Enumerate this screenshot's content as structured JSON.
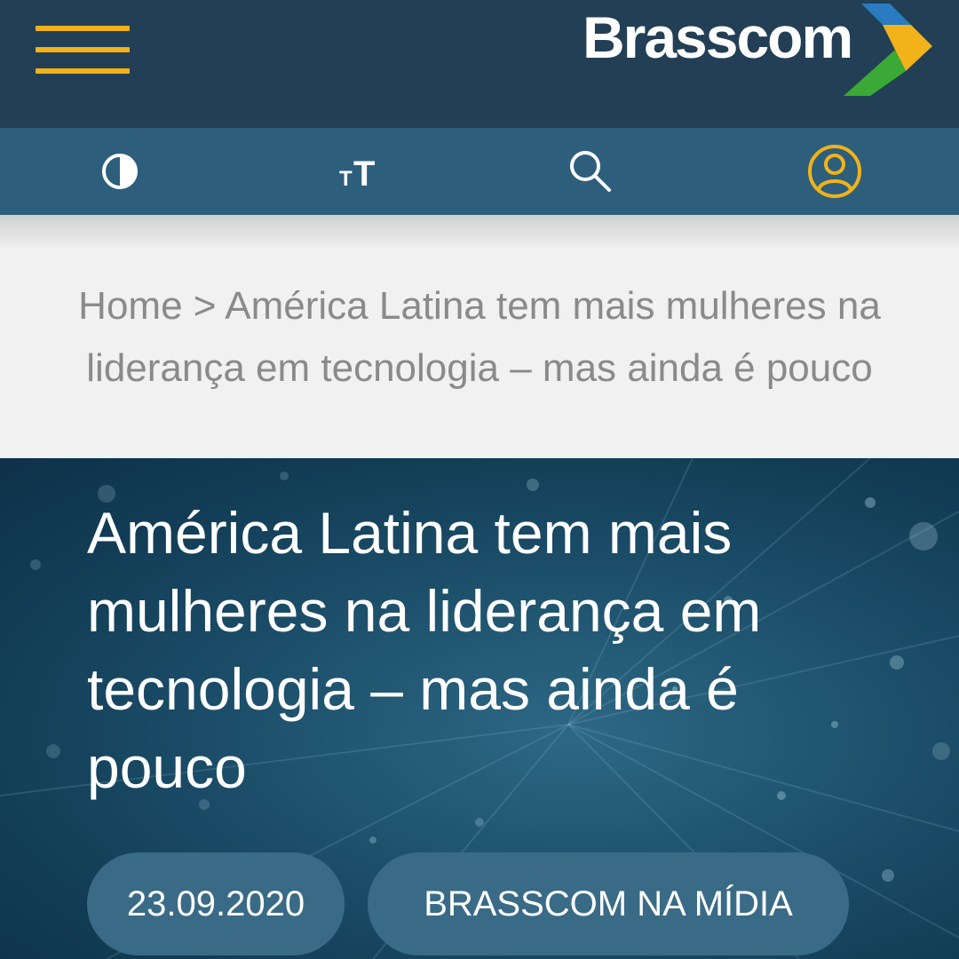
{
  "header": {
    "menu_icon": "hamburger-menu-icon",
    "logo_text": "Brasscom",
    "logo_colors": {
      "background": "#223f55",
      "menu": "#f2b21a",
      "chevron_blue": "#2a7bbf",
      "chevron_yellow": "#f2b21a",
      "chevron_green": "#3aa935"
    }
  },
  "toolbar": {
    "contrast_icon": "contrast-icon",
    "font_size_label": "тT",
    "font_size_icon": "font-size-icon",
    "search_icon": "search-icon",
    "user_icon": "user-account-icon"
  },
  "breadcrumb": {
    "home": "Home",
    "separator": ">",
    "current": "América Latina tem mais mulheres na liderança em tecnologia – mas ainda é pouco"
  },
  "article": {
    "title": "América Latina tem mais mulheres na liderança em tecnologia – mas ainda é pouco",
    "date": "23.09.2020",
    "category": "BRASSCOM NA MÍDIA"
  }
}
